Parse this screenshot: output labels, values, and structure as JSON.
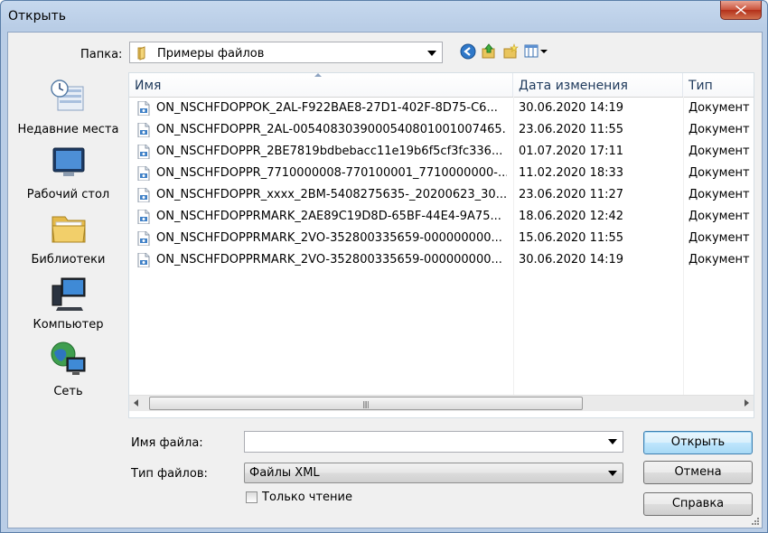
{
  "window": {
    "title": "Открыть"
  },
  "toolbar": {
    "folder_label": "Папка:",
    "folder_value": "Примеры файлов"
  },
  "places": [
    {
      "label": "Недавние места",
      "icon": "recent-places-icon"
    },
    {
      "label": "Рабочий стол",
      "icon": "desktop-icon"
    },
    {
      "label": "Библиотеки",
      "icon": "libraries-icon"
    },
    {
      "label": "Компьютер",
      "icon": "computer-icon"
    },
    {
      "label": "Сеть",
      "icon": "network-icon"
    }
  ],
  "columns": {
    "name": "Имя",
    "date": "Дата изменения",
    "type": "Тип"
  },
  "files": [
    {
      "name": "ON_NSCHFDOPPOK_2AL-F922BAE8-27D1-402F-8D75-C6...",
      "date": "30.06.2020 14:19",
      "type": "Документ XML"
    },
    {
      "name": "ON_NSCHFDOPPR_2AL-005408303900054080100100746​5...",
      "date": "23.06.2020 11:55",
      "type": "Документ XML"
    },
    {
      "name": "ON_NSCHFDOPPR_2BE7819bdbebacc11e19b6f5cf3fc336...",
      "date": "01.07.2020 17:11",
      "type": "Документ XML"
    },
    {
      "name": "ON_NSCHFDOPPR_7710000008-770100001_7710000000-...",
      "date": "11.02.2020 18:33",
      "type": "Документ XML"
    },
    {
      "name": "ON_NSCHFDOPPR_xxxx_2BM-5408275635-_20200623_30...",
      "date": "23.06.2020 11:27",
      "type": "Документ XML"
    },
    {
      "name": "ON_NSCHFDOPPRMARK_2AE89C19D8D-65BF-44E4-9A75...",
      "date": "18.06.2020 12:42",
      "type": "Документ XML"
    },
    {
      "name": "ON_NSCHFDOPPRMARK_2VO-352800335659-000000000...",
      "date": "15.06.2020 11:55",
      "type": "Документ XML"
    },
    {
      "name": "ON_NSCHFDOPPRMARK_2VO-352800335659-000000000...",
      "date": "30.06.2020 14:19",
      "type": "Документ XML"
    }
  ],
  "form": {
    "filename_label": "Имя файла:",
    "filename_value": "",
    "filetype_label": "Тип файлов:",
    "filetype_value": "Файлы XML",
    "readonly_label": "Только чтение",
    "readonly_checked": false
  },
  "buttons": {
    "open": "Открыть",
    "cancel": "Отмена",
    "help": "Справка"
  }
}
